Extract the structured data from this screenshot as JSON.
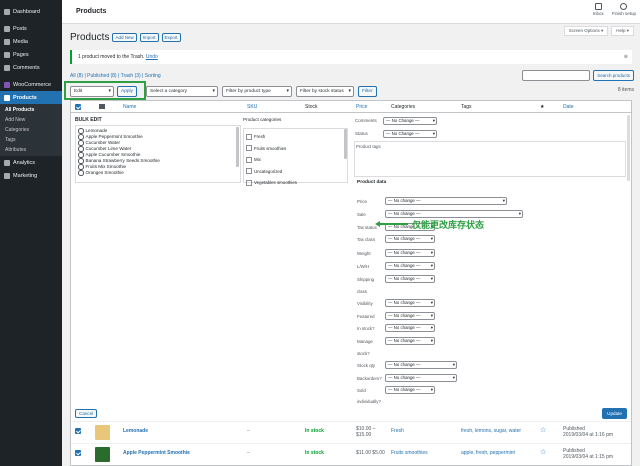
{
  "admin_menu": {
    "items": [
      {
        "label": "Dashboard",
        "icon": "dashboard-icon"
      },
      {
        "label": "Posts",
        "icon": "pin-icon"
      },
      {
        "label": "Media",
        "icon": "media-icon"
      },
      {
        "label": "Pages",
        "icon": "page-icon"
      },
      {
        "label": "Comments",
        "icon": "comment-icon"
      }
    ],
    "woocommerce": "WooCommerce",
    "products": "Products",
    "submenu": [
      "All Products",
      "Add New",
      "Categories",
      "Tags",
      "Attributes"
    ],
    "analytics": "Analytics",
    "marketing": "Marketing"
  },
  "topbar": {
    "title": "Products",
    "inbox": "Inbox",
    "finish_setup": "Finish setup"
  },
  "screen_options": "Screen Options ▾",
  "help": "Help ▾",
  "heading": {
    "title": "Products",
    "add_new": "Add New",
    "import": "Import",
    "export": "Export"
  },
  "notice": {
    "text": "1 product moved to the Trash.",
    "undo": "Undo"
  },
  "subsub": {
    "all": "All (8)",
    "published": "Published (8)",
    "trash": "Trash (3)",
    "sorting": "Sorting"
  },
  "search": {
    "button": "Search products"
  },
  "filters": {
    "bulk_action": "Edit",
    "apply": "Apply",
    "category": "Select a category",
    "product_type": "Filter by product type",
    "stock_status": "Filter by stock status",
    "filter": "Filter",
    "items": "8 items"
  },
  "columns": {
    "name": "Name",
    "sku": "SKU",
    "stock": "Stock",
    "price": "Price",
    "categories": "Categories",
    "tags": "Tags",
    "featured": "★",
    "date": "Date"
  },
  "bulk_edit": {
    "title": "BULK EDIT",
    "products": [
      "Lemonade",
      "Apple Peppermint Smoothie",
      "Cucumber Water",
      "Cucumber Lime Water",
      "Apple Cucumber Smoothie",
      "Banana Strawberry Seeds Smoothie",
      "Fruits Mix Smoothie",
      "Oranges Smoothie"
    ],
    "cat_title": "Product categories",
    "categories": [
      "Fresh",
      "Fruits smoothies",
      "Mix",
      "Uncategorized",
      "Vegetables smoothies"
    ],
    "comments_label": "Comments",
    "status_label": "Status",
    "no_change": "— No Change —",
    "tags_label": "Product tags",
    "product_data": "Product data",
    "fields": [
      {
        "label": "Price",
        "value": "— No change —"
      },
      {
        "label": "Sale",
        "value": "— No change —"
      },
      {
        "label": "Tax status",
        "value": "— No change —"
      },
      {
        "label": "Tax class",
        "value": "— No change —"
      },
      {
        "label": "Weight",
        "value": "— No change —"
      },
      {
        "label": "L/W/H",
        "value": "— No change —"
      },
      {
        "label": "Shipping",
        "value": "— No change —"
      },
      {
        "label": "class",
        "value": ""
      },
      {
        "label": "Visibility",
        "value": "— No change —"
      },
      {
        "label": "Featured",
        "value": "— No change —"
      },
      {
        "label": "In stock?",
        "value": "— No change —"
      },
      {
        "label": "Manage",
        "value": "— No change —"
      },
      {
        "label": "stock?",
        "value": ""
      },
      {
        "label": "Stock qty",
        "value": "— No change —"
      },
      {
        "label": "Backorders?",
        "value": "— No change —"
      },
      {
        "label": "Sold",
        "value": "— No change —"
      },
      {
        "label": "individually?",
        "value": ""
      }
    ],
    "annotation": "仅能更改库存状态",
    "cancel": "Cancel",
    "update": "Update"
  },
  "rows": [
    {
      "name": "Lemonade",
      "sku": "–",
      "stock": "In stock",
      "price1": "$10.00 –",
      "price2": "$15.00",
      "category": "Fresh",
      "tags": "fresh, lemons, sugar, water",
      "date1": "Published",
      "date2": "2019/03/04 at 1:16 pm",
      "thumb": "#e8c77a"
    },
    {
      "name": "Apple Peppermint Smoothie",
      "sku": "–",
      "stock": "In stock",
      "price1": "$11.00 $5.00",
      "price2": "",
      "category": "Fruits smoothies",
      "tags": "apple, fresh, peppermint",
      "date1": "Published",
      "date2": "2019/03/04 at 1:15 pm",
      "thumb": "#2b6b2e"
    }
  ]
}
